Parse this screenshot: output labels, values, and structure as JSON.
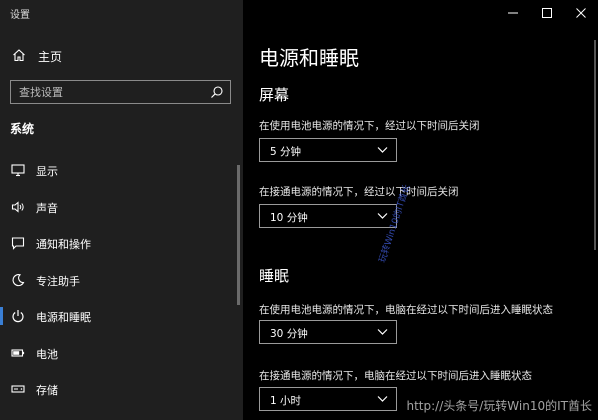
{
  "app": {
    "title": "设置"
  },
  "sidebar": {
    "home_label": "主页",
    "search": {
      "placeholder": "查找设置"
    },
    "section_label": "系统",
    "items": [
      {
        "label": "显示",
        "icon": "display-icon"
      },
      {
        "label": "声音",
        "icon": "sound-icon"
      },
      {
        "label": "通知和操作",
        "icon": "notification-icon"
      },
      {
        "label": "专注助手",
        "icon": "moon-icon"
      },
      {
        "label": "电源和睡眠",
        "icon": "power-icon",
        "selected": true
      },
      {
        "label": "电池",
        "icon": "battery-icon"
      },
      {
        "label": "存储",
        "icon": "storage-icon"
      }
    ]
  },
  "main": {
    "title": "电源和睡眠",
    "screen": {
      "title": "屏幕",
      "battery_label": "在使用电池电源的情况下，经过以下时间后关闭",
      "battery_value": "5 分钟",
      "plugged_label": "在接通电源的情况下，经过以下时间后关闭",
      "plugged_value": "10 分钟"
    },
    "sleep": {
      "title": "睡眠",
      "battery_label": "在使用电池电源的情况下，电脑在经过以下时间后进入睡眠状态",
      "battery_value": "30 分钟",
      "plugged_label": "在接通电源的情况下，电脑在经过以下时间后进入睡眠状态",
      "plugged_value": "1 小时"
    }
  },
  "watermarks": {
    "vertical": "玩转Win10的IT酋长",
    "bottom": "http://头条号/玩转Win10的IT酋长"
  },
  "colors": {
    "accent": "#3a7fd5",
    "sidebar_bg": "#1f1f1f",
    "main_bg": "#000000"
  }
}
